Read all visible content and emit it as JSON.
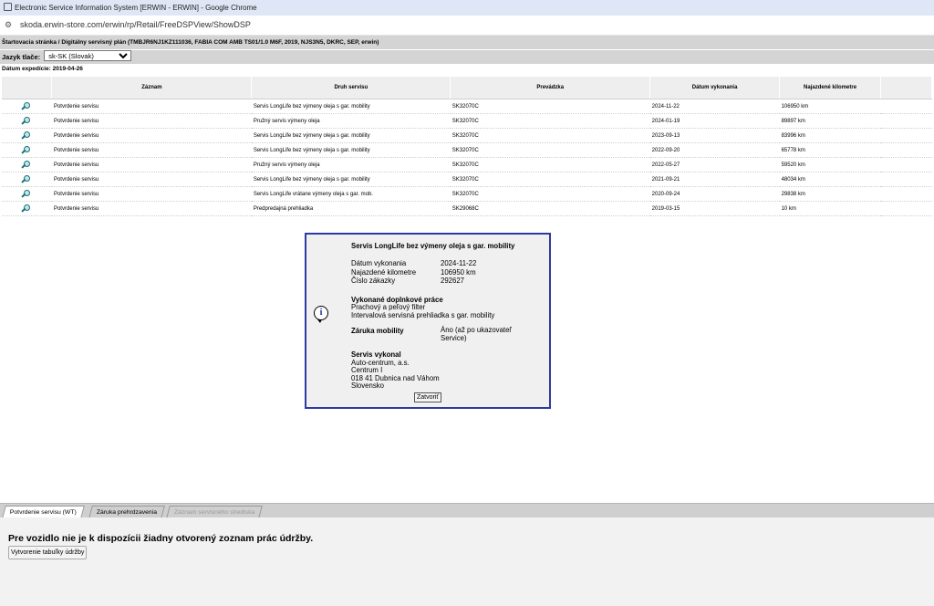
{
  "browser": {
    "window_title": "Electronic Service Information System [ERWIN - ERWIN] - Google Chrome",
    "url": "skoda.erwin-store.com/erwin/rp/Retail/FreeDSPView/ShowDSP",
    "window_icon": "page-icon",
    "site_info_icon": "tune-icon"
  },
  "breadcrumb": "Štartovacia stránka / Digitálny servisný plán (TMBJR6NJ1KZ111036, FABIA COM AMB TS01/1.0 M6F, 2019, NJS3N5, DKRC, SEP, erwin)",
  "print_lang": {
    "label": "Jazyk tlače:",
    "selected": "sk-SK (Slovak)"
  },
  "expedition": "Dátum expedície: 2019-04-26",
  "table": {
    "headers": [
      "Záznam",
      "Druh servisu",
      "Prevádzka",
      "Dátum vykonania",
      "Najazdené kilometre"
    ],
    "rows": [
      {
        "record": "Potvrdenie servisu",
        "type": "Servis LongLife bez výmeny oleja s gar. mobility",
        "shop": "SK32070C",
        "date": "2024-11-22",
        "km": "106950 km"
      },
      {
        "record": "Potvrdenie servisu",
        "type": "Pružný servis výmeny oleja",
        "shop": "SK32070C",
        "date": "2024-01-19",
        "km": "89897 km"
      },
      {
        "record": "Potvrdenie servisu",
        "type": "Servis LongLife bez výmeny oleja s gar. mobility",
        "shop": "SK32070C",
        "date": "2023-09-13",
        "km": "83996 km"
      },
      {
        "record": "Potvrdenie servisu",
        "type": "Servis LongLife bez výmeny oleja s gar. mobility",
        "shop": "SK32070C",
        "date": "2022-09-20",
        "km": "65778 km"
      },
      {
        "record": "Potvrdenie servisu",
        "type": "Pružný servis výmeny oleja",
        "shop": "SK32070C",
        "date": "2022-05-27",
        "km": "59520 km"
      },
      {
        "record": "Potvrdenie servisu",
        "type": "Servis LongLife bez výmeny oleja s gar. mobility",
        "shop": "SK32070C",
        "date": "2021-09-21",
        "km": "48034 km"
      },
      {
        "record": "Potvrdenie servisu",
        "type": "Servis LongLife vrátane výmeny oleja s gar. mob.",
        "shop": "SK32070C",
        "date": "2020-09-24",
        "km": "29838 km"
      },
      {
        "record": "Potvrdenie servisu",
        "type": "Predpredajná prehliadka",
        "shop": "SK29068C",
        "date": "2019-03-15",
        "km": "10 km"
      }
    ]
  },
  "dialog": {
    "title": "Servis LongLife bez výmeny oleja s gar. mobility",
    "date_label": "Dátum vykonania",
    "date_value": "2024-11-22",
    "km_label": "Najazdené kilometre",
    "km_value": "106950 km",
    "order_label": "Číslo zákazky",
    "order_value": "292627",
    "extra_heading": "Vykonané doplnkové práce",
    "extra_1": "Prachový a peľový filter",
    "extra_2": "Intervalová servisná prehliadka s gar. mobility",
    "mobility_label": "Záruka mobility",
    "mobility_value": "Áno (až po ukazovateľ Service)",
    "performed_heading": "Servis vykonal",
    "company": "Auto-centrum, a.s.",
    "street": "Centrum I",
    "city": "018 41 Dubnica nad Váhom",
    "country": "Slovensko",
    "close_label": "Zatvoriť",
    "icon": "info-icon"
  },
  "tabs": [
    {
      "label": "Potvrdenie servisu (WT)",
      "state": "active"
    },
    {
      "label": "Záruka prehrdzavenia",
      "state": "normal"
    },
    {
      "label": "Záznam servisného strediska",
      "state": "disabled"
    }
  ],
  "bottom": {
    "message": "Pre vozidlo nie je k dispozícii žiadny otvorený zoznam prác údržby.",
    "button": "Vytvorenie tabuľky údržby"
  }
}
